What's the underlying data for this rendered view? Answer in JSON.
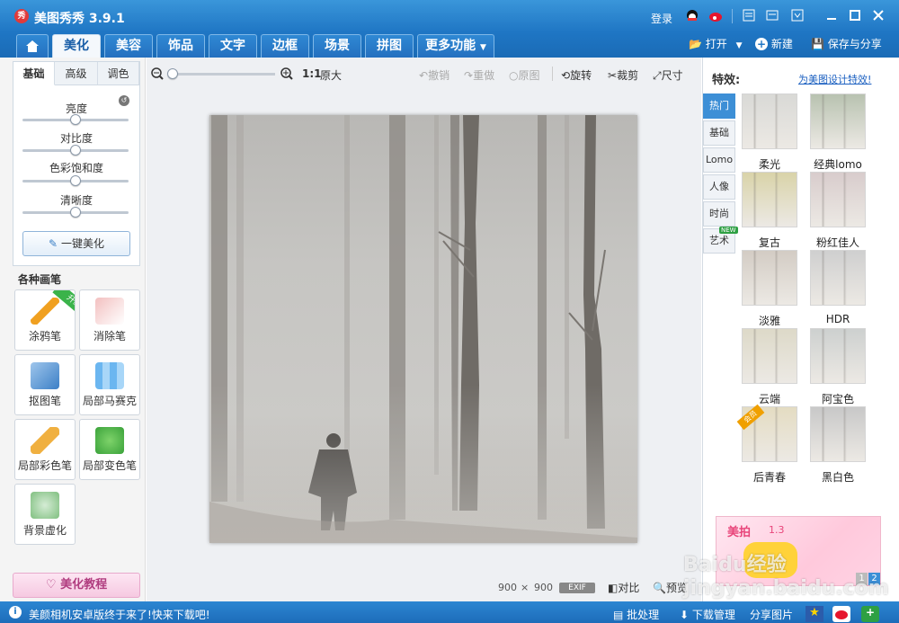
{
  "app": {
    "title": "美图秀秀 3.9.1",
    "logo_text": "秀",
    "login": "登录"
  },
  "tabs": [
    "美化",
    "美容",
    "饰品",
    "文字",
    "边框",
    "场景",
    "拼图",
    "更多功能"
  ],
  "header_actions": {
    "open": "打开",
    "new": "新建",
    "save": "保存与分享"
  },
  "adjust": {
    "subtabs": [
      "基础",
      "高级",
      "调色"
    ],
    "sliders": [
      {
        "label": "亮度",
        "value": 0.5
      },
      {
        "label": "对比度",
        "value": 0.5
      },
      {
        "label": "色彩饱和度",
        "value": 0.5
      },
      {
        "label": "清晰度",
        "value": 0.5
      }
    ],
    "onekey": "一键美化"
  },
  "brushes": {
    "title": "各种画笔",
    "upgrade_badge": "升级",
    "items": [
      "涂鸦笔",
      "消除笔",
      "抠图笔",
      "局部马赛克",
      "局部彩色笔",
      "局部变色笔",
      "背景虚化"
    ]
  },
  "tutorial": "美化教程",
  "toolbar": {
    "zoom_ratio": "1:1",
    "original_size": "原大",
    "undo": "撤销",
    "redo": "重做",
    "original": "原图",
    "rotate": "旋转",
    "crop": "裁剪",
    "resize": "尺寸"
  },
  "image_info": {
    "width": "900",
    "times": "×",
    "height": "900",
    "exif": "EXIF",
    "compare": "对比",
    "preview": "预览"
  },
  "effects": {
    "title": "特效:",
    "design_link": "为美图设计特效!",
    "categories": [
      "热门",
      "基础",
      "Lomo",
      "人像",
      "时尚",
      "艺术"
    ],
    "new_badge": "NEW",
    "items": [
      {
        "name": "柔光",
        "color": "#d9d9d6"
      },
      {
        "name": "经典lomo",
        "color": "#b8c2b0"
      },
      {
        "name": "复古",
        "color": "#d9d3a8"
      },
      {
        "name": "粉红佳人",
        "color": "#d8cccc"
      },
      {
        "name": "淡雅",
        "color": "#d3ccc4"
      },
      {
        "name": "HDR",
        "color": "#cfcfcf"
      },
      {
        "name": "云端",
        "color": "#ddd9c8"
      },
      {
        "name": "阿宝色",
        "color": "#cdd0cf"
      },
      {
        "name": "后青春",
        "color": "#e4dcc2"
      },
      {
        "name": "黑白色",
        "color": "#c8c8c8"
      }
    ],
    "vip_badge": "会员",
    "ad": {
      "brand": "美拍",
      "version": "1.3",
      "pages": [
        "1",
        "2"
      ]
    }
  },
  "statusbar": {
    "message": "美颜相机安卓版终于来了!快来下载吧!",
    "batch": "批处理",
    "downloads": "下载管理",
    "share": "分享图片"
  },
  "watermark": "Baidu经验 jingyan.baidu.com"
}
